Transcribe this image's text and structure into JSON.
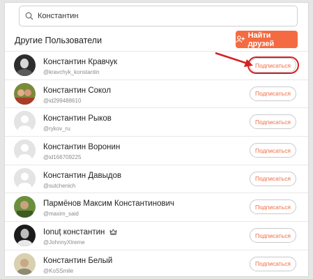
{
  "search": {
    "value": "Константин",
    "placeholder": ""
  },
  "section": {
    "title": "Другие Пользователи"
  },
  "find_friends_button": {
    "label": "Найти друзей"
  },
  "users": [
    {
      "name": "Константин Кравчук",
      "handle": "@kravchyk_konstantin",
      "button": "Подписаться",
      "avatar": "photo-dark"
    },
    {
      "name": "Константин Сокол",
      "handle": "@id299488610",
      "button": "Подписаться",
      "avatar": "photo-group"
    },
    {
      "name": "Константин Рыков",
      "handle": "@rykov_ru",
      "button": "Подписаться",
      "avatar": "placeholder"
    },
    {
      "name": "Константин Воронин",
      "handle": "@id166709225",
      "button": "Подписаться",
      "avatar": "placeholder"
    },
    {
      "name": "Константин Давыдов",
      "handle": "@sutchenich",
      "button": "Подписаться",
      "avatar": "placeholder"
    },
    {
      "name": "Пармёнов Максим Константинович",
      "handle": "@maxim_said",
      "button": "Подписаться",
      "avatar": "photo-green"
    },
    {
      "name": "Ionuț константин",
      "handle": "@JohnnyXtreme",
      "button": "Подписаться",
      "avatar": "photo-bw",
      "badge": "crown-icon"
    },
    {
      "name": "Константин Белый",
      "handle": "@KoSSmile",
      "button": "Подписаться",
      "avatar": "photo-pale"
    }
  ],
  "colors": {
    "accent": "#f46b41",
    "highlight": "#d52121"
  }
}
